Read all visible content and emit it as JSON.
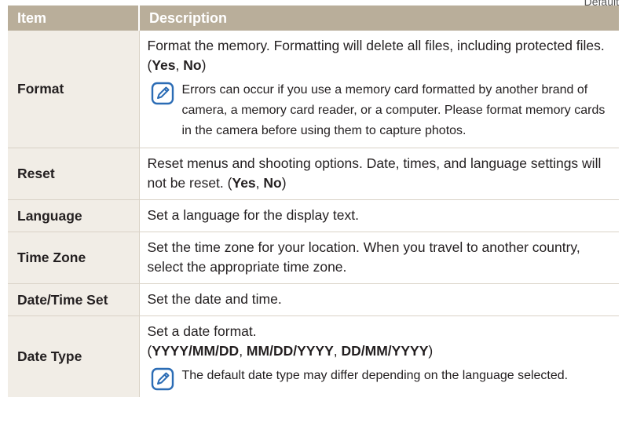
{
  "corner_label": "Default",
  "table": {
    "headers": {
      "item": "Item",
      "description": "Description"
    },
    "rows": [
      {
        "item": "Format",
        "description": "Format the memory. Formatting will delete all files, including protected files. (",
        "options": [
          "Yes",
          "No"
        ],
        "note": "Errors can occur if you use a memory card formatted by another brand of camera, a memory card reader, or a computer. Please format memory cards in the camera before using them to capture photos."
      },
      {
        "item": "Reset",
        "description": "Reset menus and shooting options. Date, times, and language settings will not be reset. (",
        "options": [
          "Yes",
          "No"
        ]
      },
      {
        "item": "Language",
        "description": "Set a language for the display text."
      },
      {
        "item": "Time Zone",
        "description": "Set the time zone for your location. When you travel to another country, select the appropriate time zone."
      },
      {
        "item": "Date/Time Set",
        "description": "Set the date and time."
      },
      {
        "item": "Date Type",
        "description": "Set a date format.",
        "options": [
          "YYYY/MM/DD",
          "MM/DD/YYYY",
          "DD/MM/YYYY"
        ],
        "note": "The default date type may differ depending on the language selected."
      }
    ]
  },
  "icons": {
    "note": "note-pencil-icon"
  },
  "colors": {
    "header_bg": "#b9ae9a",
    "item_bg": "#f1ede6",
    "icon_blue": "#2b6cb5"
  }
}
